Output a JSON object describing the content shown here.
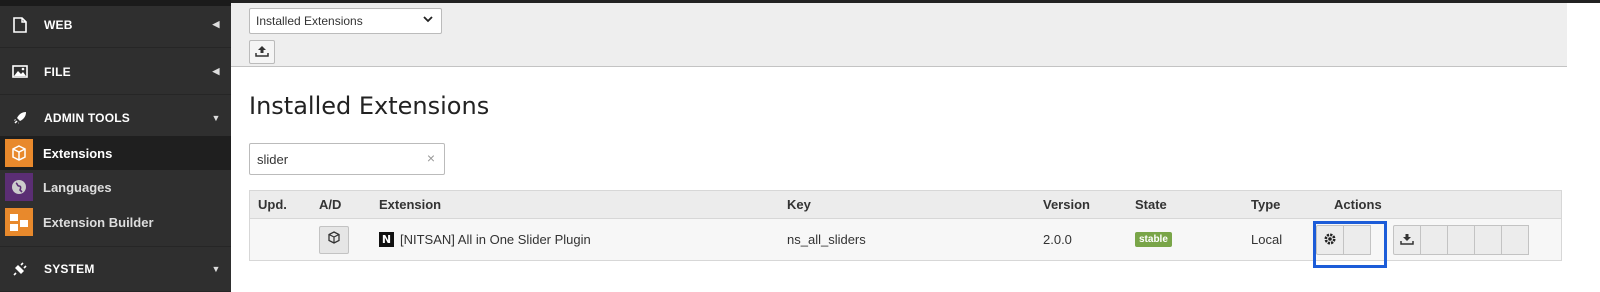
{
  "sidebar": {
    "groups": [
      {
        "label": "WEB",
        "icon": "page-icon",
        "caret": "◀"
      },
      {
        "label": "FILE",
        "icon": "image-icon",
        "caret": "◀"
      },
      {
        "label": "ADMIN TOOLS",
        "icon": "rocket-icon",
        "caret": "▼"
      },
      {
        "label": "SYSTEM",
        "icon": "plug-icon",
        "caret": "▼"
      }
    ],
    "items": [
      {
        "label": "Extensions",
        "icon": "cube-icon",
        "color": "#e8892c",
        "active": true
      },
      {
        "label": "Languages",
        "icon": "globe-icon",
        "color": "#5b2e74",
        "active": false
      },
      {
        "label": "Extension Builder",
        "icon": "builder-icon",
        "color": "#e8892c",
        "active": false
      }
    ]
  },
  "toolbar": {
    "view_select": "Installed Extensions",
    "upload_icon": "upload-icon"
  },
  "main": {
    "title": "Installed Extensions",
    "search_value": "slider",
    "clear_icon": "×"
  },
  "table": {
    "headers": {
      "upd": "Upd.",
      "ad": "A/D",
      "extension": "Extension",
      "key": "Key",
      "version": "Version",
      "state": "State",
      "type": "Type",
      "actions": "Actions"
    },
    "rows": [
      {
        "logo": "N",
        "extension": "[NITSAN] All in One Slider Plugin",
        "key": "ns_all_sliders",
        "version": "2.0.0",
        "state": "stable",
        "type": "Local"
      }
    ]
  },
  "colors": {
    "sidebar_bg": "#2f2f2f",
    "accent_orange": "#e8892c",
    "state_stable": "#79a548",
    "highlight_box": "#1c5cd8"
  }
}
